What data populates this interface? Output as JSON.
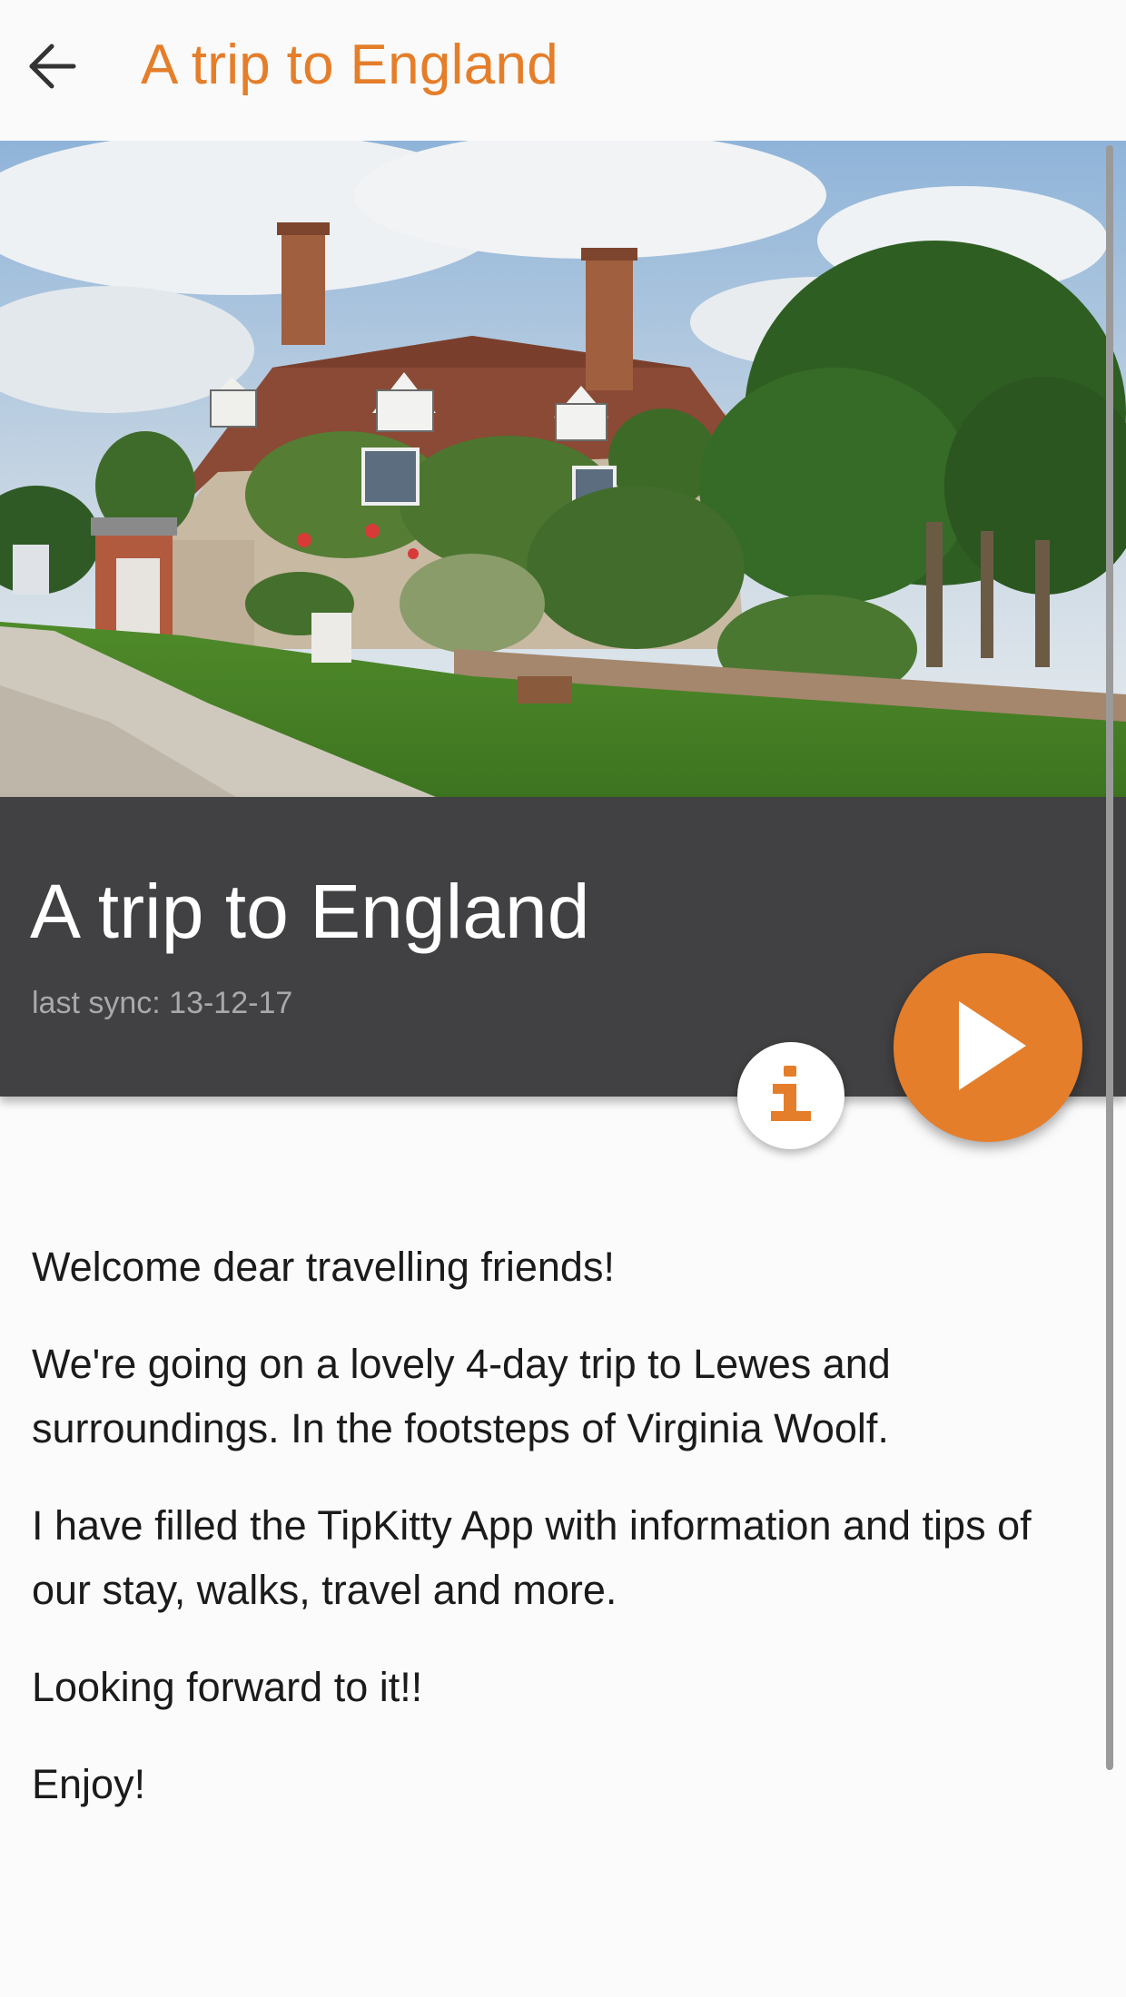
{
  "appbar": {
    "back_icon": "arrow-left-icon",
    "title": "A trip to England"
  },
  "hero": {
    "image": "country-house-photo"
  },
  "header": {
    "title": "A trip to England",
    "sync": "last sync: 13-12-17"
  },
  "actions": {
    "info_icon": "info-icon",
    "play_icon": "play-icon"
  },
  "body": {
    "paragraphs": [
      "Welcome dear travelling friends!",
      "We're going on a lovely 4-day trip to Lewes and surroundings. In the footsteps of Virginia Woolf.",
      "I have filled the TipKitty App with information and tips of our stay, walks, travel and more.",
      "Looking forward to it!!",
      "Enjoy!"
    ]
  },
  "colors": {
    "accent": "#e57e2a",
    "band": "#414042",
    "background": "#fbfbfb"
  }
}
